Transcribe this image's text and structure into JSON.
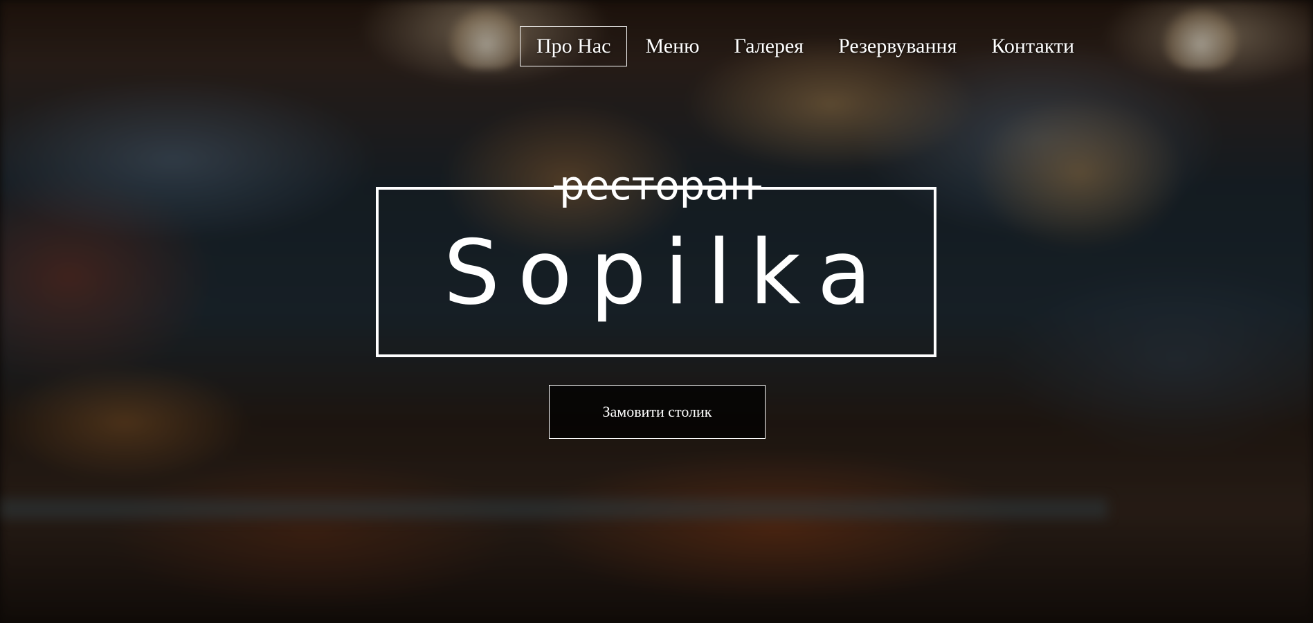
{
  "nav": {
    "items": [
      {
        "label": "Про Нас",
        "active": true
      },
      {
        "label": "Меню",
        "active": false
      },
      {
        "label": "Галерея",
        "active": false
      },
      {
        "label": "Резервування",
        "active": false
      },
      {
        "label": "Контакти",
        "active": false
      }
    ]
  },
  "hero": {
    "subtitle": "ресторан",
    "title": "Sopilka",
    "cta_label": "Замовити столик"
  },
  "colors": {
    "text": "#ffffff",
    "button_bg": "#000000",
    "border": "#ffffff"
  }
}
